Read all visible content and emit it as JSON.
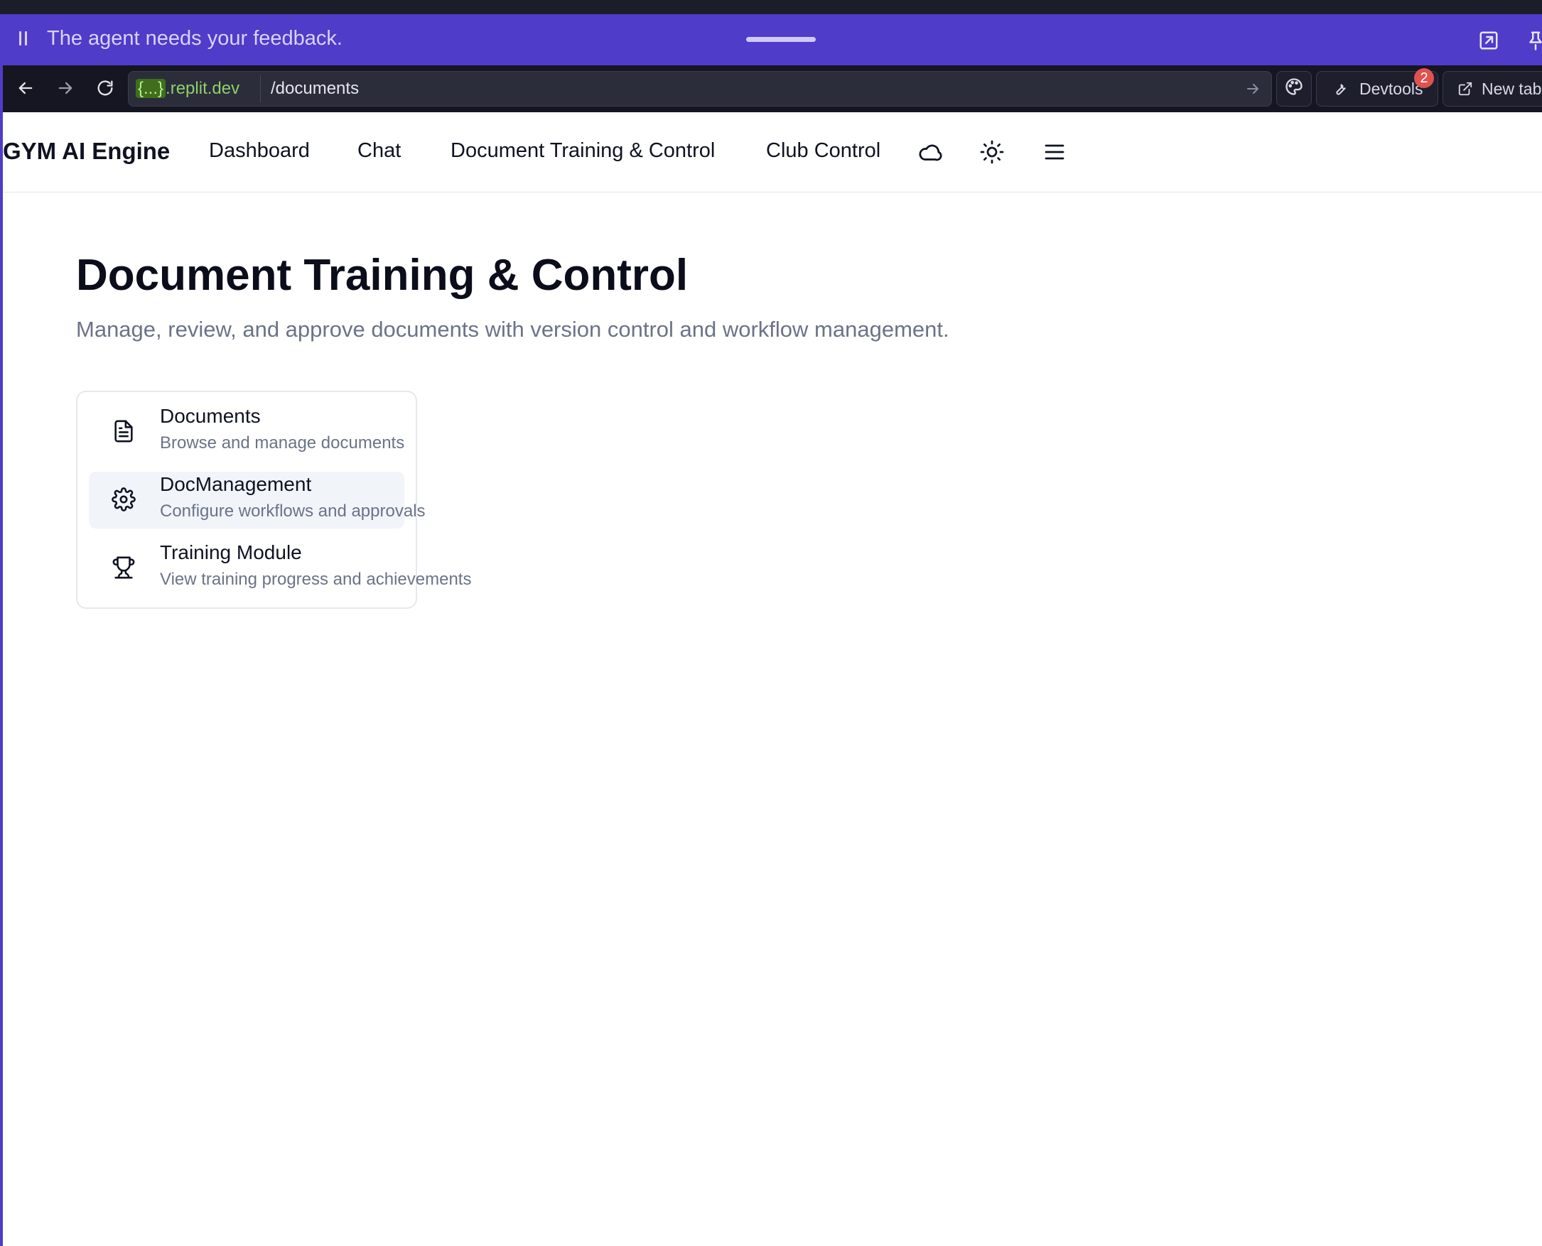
{
  "agent_banner": {
    "message": "The agent needs your feedback."
  },
  "browser": {
    "url_host_highlight": "{...}",
    "url_host_rest": ".replit.dev",
    "url_path": "/documents",
    "devtools_label": "Devtools",
    "devtools_badge": "2",
    "new_tab_label": "New tab"
  },
  "app": {
    "brand": "GYM AI Engine",
    "nav": [
      {
        "label": "Dashboard"
      },
      {
        "label": "Chat"
      },
      {
        "label": "Document Training & Control"
      },
      {
        "label": "Club Control"
      }
    ]
  },
  "page": {
    "title": "Document Training & Control",
    "subtitle": "Manage, review, and approve documents with version control and workflow management."
  },
  "menu": {
    "items": [
      {
        "title": "Documents",
        "description": "Browse and manage documents",
        "icon": "file-text-icon"
      },
      {
        "title": "DocManagement",
        "description": "Configure workflows and approvals",
        "icon": "gear-icon"
      },
      {
        "title": "Training Module",
        "description": "View training progress and achievements",
        "icon": "trophy-icon"
      }
    ]
  },
  "colors": {
    "agent_banner": "#4f3cc9",
    "browser_bar": "#151622",
    "url_host": "#8fd068",
    "badge": "#e0524f",
    "active_item_bg": "#f1f4f9"
  }
}
